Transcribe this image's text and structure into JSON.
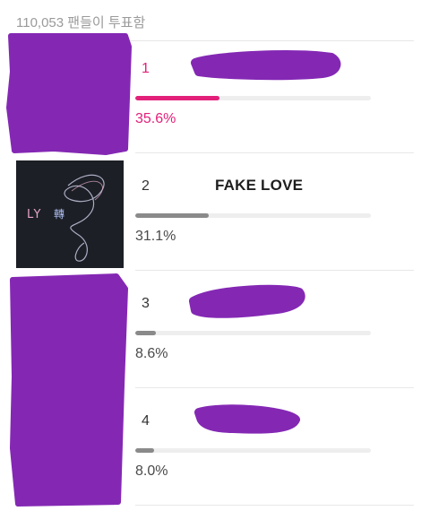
{
  "header": {
    "vote_count_text": "110,053 팬들이 투표함"
  },
  "colors": {
    "accent": "#e2207a",
    "bar_default": "#8a8a8a",
    "bar_track": "#eeeeee",
    "redaction": "#8428b4"
  },
  "results": [
    {
      "rank": "1",
      "title": "",
      "percent_text": "35.6%",
      "percent": 35.6,
      "thumb": "redacted",
      "title_redacted": true
    },
    {
      "rank": "2",
      "title": "FAKE LOVE",
      "percent_text": "31.1%",
      "percent": 31.1,
      "thumb": "album-art",
      "title_redacted": false
    },
    {
      "rank": "3",
      "title": "",
      "percent_text": "8.6%",
      "percent": 8.6,
      "thumb": "redacted",
      "title_redacted": true
    },
    {
      "rank": "4",
      "title": "",
      "percent_text": "8.0%",
      "percent": 8.0,
      "thumb": "redacted",
      "title_redacted": true
    }
  ]
}
